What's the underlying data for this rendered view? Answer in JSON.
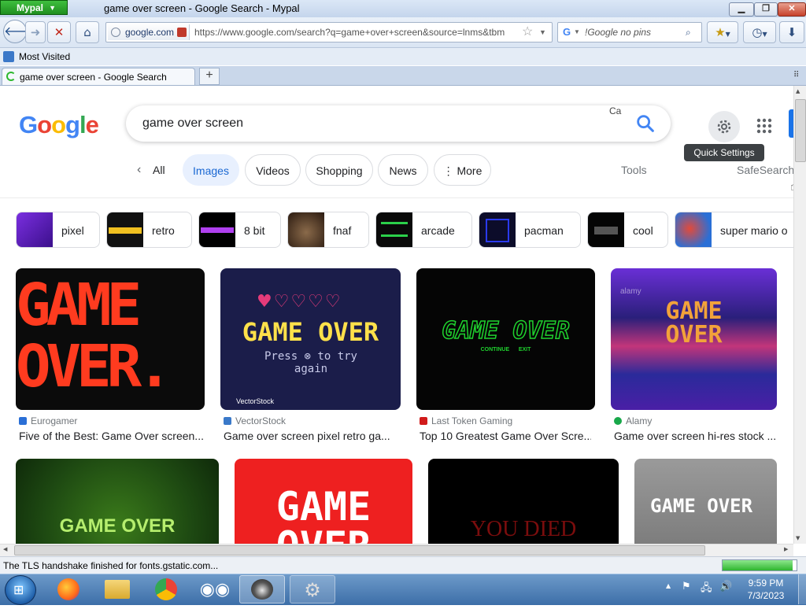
{
  "browser": {
    "brand": "Mypal",
    "window_title": "game over screen - Google Search - Mypal",
    "site_identity": "google.com",
    "url": "https://www.google.com/search?q=game+over+screen&source=lnms&tbm",
    "search_placeholder": "!Google no pins",
    "bookmarks_item": "Most Visited",
    "tab_title": "game over screen - Google Search",
    "status_text": "The TLS handshake finished for fonts.gstatic.com...",
    "progress_fraction": 0.95
  },
  "google": {
    "logo": [
      "G",
      "o",
      "o",
      "g",
      "l",
      "e"
    ],
    "logo_colors": [
      "#4285F4",
      "#EA4335",
      "#FBBC05",
      "#4285F4",
      "#34A853",
      "#EA4335"
    ],
    "query": "game over screen",
    "camera_hint": "Ca",
    "tooltip": "Quick Settings",
    "filters": [
      "All",
      "Images",
      "Videos",
      "Shopping",
      "News",
      "More"
    ],
    "tools": "Tools",
    "safesearch": "SafeSearch"
  },
  "refinements": [
    {
      "label": "pixel",
      "color": "#6a1fc9"
    },
    {
      "label": "retro",
      "color": "#111111"
    },
    {
      "label": "8 bit",
      "color": "#000000"
    },
    {
      "label": "fnaf",
      "color": "#4a3a2a"
    },
    {
      "label": "arcade",
      "color": "#0a0a0a"
    },
    {
      "label": "pacman",
      "color": "#101030"
    },
    {
      "label": "cool",
      "color": "#050505"
    },
    {
      "label": "super mario o",
      "color": "#c23b2b"
    }
  ],
  "results": [
    {
      "source": "Eurogamer",
      "title": "Five of the Best: Game Over screen...",
      "favicon_color": "#2a6fd6",
      "text": "GAME OVER.",
      "text_color": "#ff3b1f",
      "bg": "#0b0b0b"
    },
    {
      "source": "VectorStock",
      "title": "Game over screen pixel retro ga...",
      "favicon_color": "#3a79c9",
      "text": "GAME OVER",
      "subtext": "Press ⊗ to try again",
      "watermark": "VectorStock",
      "text_color": "#ffe14a",
      "bg": "#1b1d4a"
    },
    {
      "source": "Last Token Gaming",
      "title": "Top 10 Greatest Game Over Scre...",
      "favicon_color": "#d11b1b",
      "text": "GAME OVER",
      "subtext": "CONTINUE      EXIT",
      "text_color": "#1fd12e",
      "bg": "#050505"
    },
    {
      "source": "Alamy",
      "title": "Game over screen hi-res stock ...",
      "favicon_color": "#18a84a",
      "text": "GAME OVER",
      "watermark": "alamy",
      "text_color": "#f2a23a",
      "bg": "#3a2d8a"
    },
    {
      "text": "GAME OVER",
      "text_color": "#b6ee6e",
      "bg": "#1e4a12"
    },
    {
      "text": "GAME OVER",
      "text_color": "#ffffff",
      "bg": "#ee2020"
    },
    {
      "text": "YOU DIED",
      "text_color": "#7a0d0d",
      "bg": "#000000"
    },
    {
      "text": "GAME OVER",
      "text_color": "#ffffff",
      "bg": "#8a8a8a"
    }
  ],
  "taskbar": {
    "time": "9:59 PM",
    "date": "7/3/2023"
  }
}
